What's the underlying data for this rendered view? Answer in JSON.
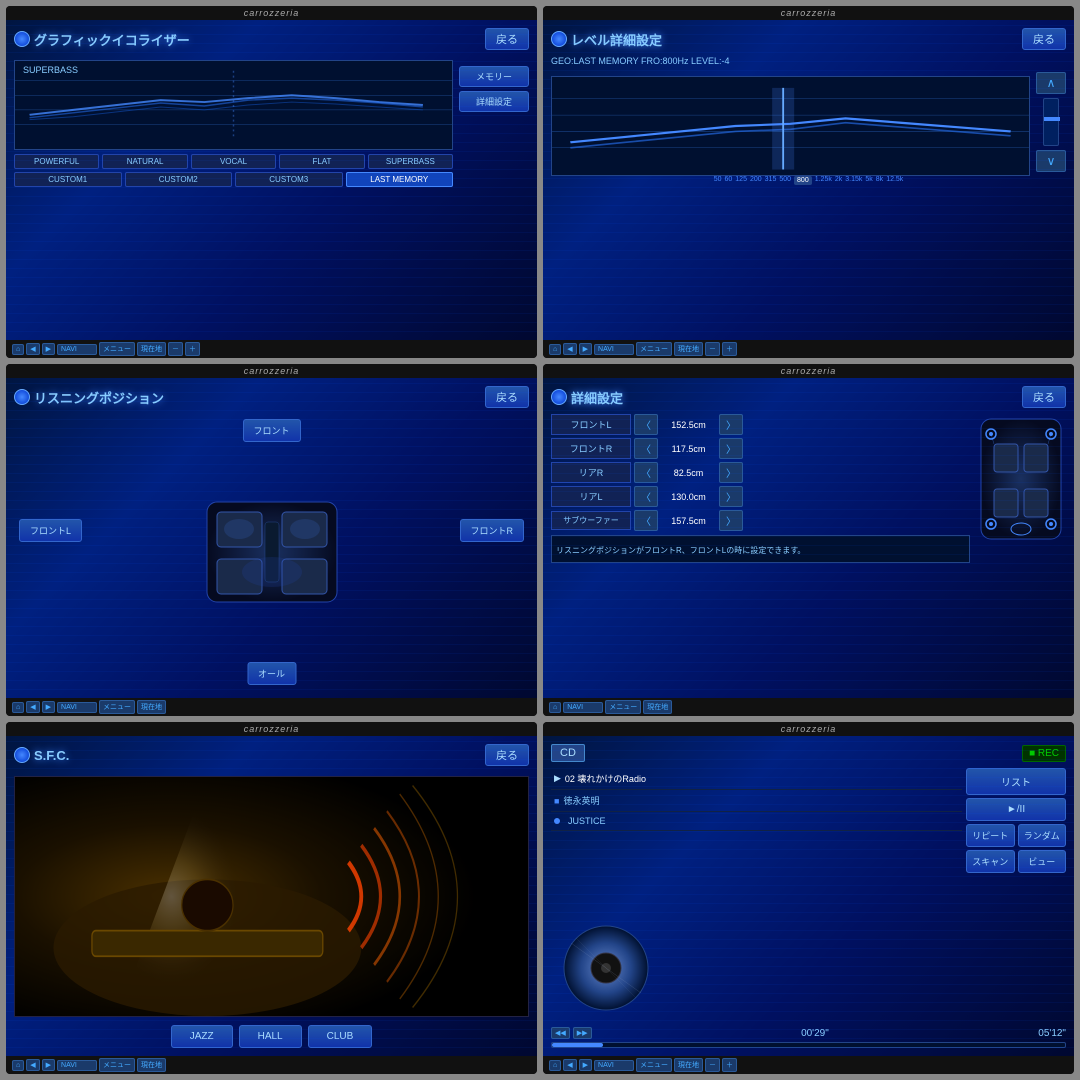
{
  "brand": "carrozzeria",
  "panels": [
    {
      "id": "eq-panel",
      "title": "グラフィックイコライザー",
      "back_label": "戻る",
      "superbass_label": "SUPERBASS",
      "memory_btn": "メモリー",
      "detail_btn": "詳細設定",
      "presets_row1": [
        "POWERFUL",
        "NATURAL",
        "VOCAL",
        "FLAT",
        "SUPERBASS"
      ],
      "presets_row2": [
        "CUSTOM1",
        "CUSTOM2",
        "CUSTOM3",
        "LAST MEMORY"
      ],
      "active_preset": "LAST MEMORY"
    },
    {
      "id": "level-panel",
      "title": "レベル詳細設定",
      "back_label": "戻る",
      "geo_info": "GEO:LAST MEMORY  FRO:800Hz  LEVEL:-4",
      "freq_labels": [
        "50",
        "60",
        "125",
        "200",
        "315",
        "500",
        "800",
        "1.25k",
        "2k",
        "3.15k",
        "5k",
        "8k",
        "12.5k"
      ],
      "active_freq": "800"
    },
    {
      "id": "listen-panel",
      "title": "リスニングポジション",
      "back_label": "戻る",
      "front_btn": "フロント",
      "front_l_btn": "フロントL",
      "front_r_btn": "フロントR",
      "all_btn": "オール"
    },
    {
      "id": "detail-panel",
      "title": "詳細設定",
      "back_label": "戻る",
      "rows": [
        {
          "label": "フロントL",
          "value": "152.5cm"
        },
        {
          "label": "フロントR",
          "value": "117.5cm"
        },
        {
          "label": "リアR",
          "value": "82.5cm"
        },
        {
          "label": "リアL",
          "value": "130.0cm"
        },
        {
          "label": "サブウーファー",
          "value": "157.5cm"
        }
      ],
      "note": "リスニングポジションがフロントR、フロントLの時に設定できます。"
    },
    {
      "id": "sfc-panel",
      "title": "S.F.C.",
      "back_label": "戻る",
      "presets": [
        "JAZZ",
        "HALL",
        "CLUB"
      ]
    },
    {
      "id": "cd-panel",
      "title": "CD",
      "rec_label": "■ REC",
      "tracks": [
        {
          "marker": "▶",
          "text": "02 壊れかけのRadio"
        },
        {
          "marker": "■",
          "text": "徳永英明"
        },
        {
          "marker": "●",
          "text": "JUSTICE"
        }
      ],
      "controls": {
        "list": "リスト",
        "play_pause": "►/II",
        "repeat": "リピート",
        "random": "ランダム",
        "scan": "スキャン",
        "view": "ビュー"
      },
      "time_current": "00'29\"",
      "time_total": "05'12\""
    }
  ]
}
